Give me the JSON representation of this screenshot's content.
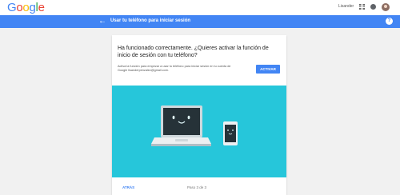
{
  "topbar": {
    "logo": [
      "G",
      "o",
      "o",
      "g",
      "l",
      "e"
    ],
    "logo_colors": [
      "#4285f4",
      "#ea4335",
      "#fbbc05",
      "#4285f4",
      "#34a853",
      "#ea4335"
    ],
    "user_name": "Lisander",
    "apps_icon": "apps-grid-icon",
    "notifications_icon": "notifications-icon",
    "avatar_icon": "account-avatar"
  },
  "header": {
    "back_arrow": "←",
    "title": "Usar tu teléfono para iniciar sesión",
    "help_symbol": "?",
    "color": "#4285f4"
  },
  "card": {
    "title": "Ha funcionado correctamente. ¿Quieres activar la función de inicio de sesión con tu teléfono?",
    "description": "Activa la función para empezar a usar tu teléfono para iniciar sesión en tu cuenta de Google lisanderpenzalez@gmail.com.",
    "activate_label": "ACTIVAR",
    "back_label": "ATRÁS",
    "step_text": "Paso 3 de 3",
    "illustration_color": "#26c6da"
  }
}
